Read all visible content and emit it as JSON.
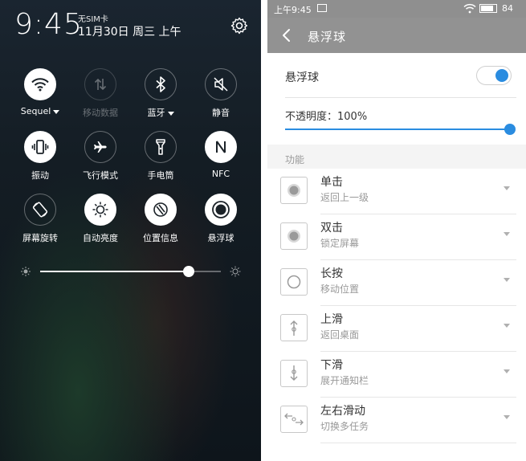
{
  "notification_shade": {
    "time": "9:45",
    "sim_status": "无SIM卡",
    "date": "11月30日 周三 上午",
    "toggles": [
      {
        "label": "Sequel",
        "icon": "wifi-icon",
        "on": true,
        "has_dropdown": true
      },
      {
        "label": "移动数据",
        "icon": "mobile-data-icon",
        "on": false,
        "disabled": true
      },
      {
        "label": "蓝牙",
        "icon": "bluetooth-icon",
        "on": false,
        "has_dropdown": true
      },
      {
        "label": "静音",
        "icon": "mute-icon",
        "on": false
      },
      {
        "label": "振动",
        "icon": "vibrate-icon",
        "on": true
      },
      {
        "label": "飞行模式",
        "icon": "airplane-icon",
        "on": false
      },
      {
        "label": "手电筒",
        "icon": "flashlight-icon",
        "on": false
      },
      {
        "label": "NFC",
        "icon": "nfc-icon",
        "on": true
      },
      {
        "label": "屏幕旋转",
        "icon": "rotate-icon",
        "on": false
      },
      {
        "label": "自动亮度",
        "icon": "auto-brightness-icon",
        "on": true
      },
      {
        "label": "位置信息",
        "icon": "location-icon",
        "on": true
      },
      {
        "label": "悬浮球",
        "icon": "floating-ball-icon",
        "on": true
      }
    ],
    "brightness_fraction": 0.82
  },
  "settings": {
    "status_time": "上午9:45",
    "battery": "84",
    "title": "悬浮球",
    "toggle_label": "悬浮球",
    "toggle_on": true,
    "opacity_label": "不透明度：100%",
    "opacity_fraction": 1.0,
    "section_label": "功能",
    "gestures": [
      {
        "title": "单击",
        "action": "返回上一级",
        "icon": "dot-icon"
      },
      {
        "title": "双击",
        "action": "锁定屏幕",
        "icon": "dot-icon"
      },
      {
        "title": "长按",
        "action": "移动位置",
        "icon": "ring-icon"
      },
      {
        "title": "上滑",
        "action": "返回桌面",
        "icon": "swipe-up-icon"
      },
      {
        "title": "下滑",
        "action": "展开通知栏",
        "icon": "swipe-down-icon"
      },
      {
        "title": "左右滑动",
        "action": "切换多任务",
        "icon": "swipe-horizontal-icon"
      }
    ]
  },
  "colors": {
    "accent": "#2a8ce0",
    "titlebar": "#929292"
  }
}
